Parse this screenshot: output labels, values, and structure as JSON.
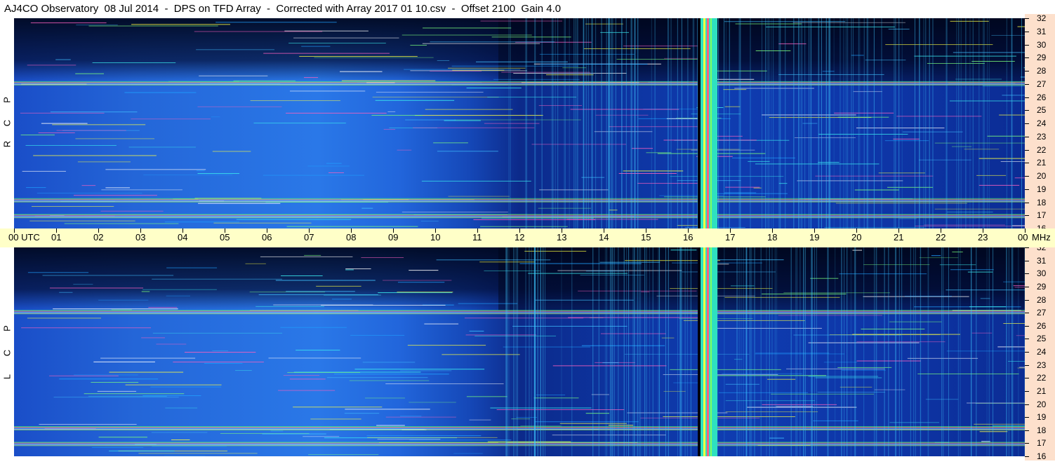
{
  "header": {
    "title": "AJ4CO Observatory  08 Jul 2014  -  DPS on TFD Array  -  Corrected with Array 2017 01 10.csv  -  Offset 2100  Gain 4.0"
  },
  "panels": [
    {
      "id": "rcp",
      "polarization_letters": [
        "R",
        "C",
        "P"
      ]
    },
    {
      "id": "lcp",
      "polarization_letters": [
        "L",
        "C",
        "P"
      ]
    }
  ],
  "time_axis": {
    "labels": [
      "00  UTC",
      "01",
      "02",
      "03",
      "04",
      "05",
      "06",
      "07",
      "08",
      "09",
      "10",
      "11",
      "12",
      "13",
      "14",
      "15",
      "16",
      "17",
      "18",
      "19",
      "20",
      "21",
      "22",
      "23",
      "00"
    ],
    "unit": "MHz"
  },
  "freq_axis": {
    "labels": [
      "32",
      "31",
      "30",
      "29",
      "28",
      "27",
      "26",
      "25",
      "24",
      "23",
      "22",
      "21",
      "20",
      "19",
      "18",
      "17",
      "16"
    ]
  },
  "colors": {
    "background_dark": "#000a3c",
    "background_blue": "#1e5ad2",
    "time_axis_bg": "#ffffc8",
    "freq_axis_bg": "#fde0cc"
  },
  "chart_data": {
    "type": "heatmap",
    "title": "AJ4CO Observatory  08 Jul 2014  -  DPS on TFD Array  -  Corrected with Array 2017 01 10.csv  -  Offset 2100  Gain 4.0",
    "xlabel": "UTC",
    "ylabel": "MHz",
    "x_range": [
      0,
      24
    ],
    "y_range": [
      16,
      32
    ],
    "panels": [
      "RCP",
      "LCP"
    ],
    "features": {
      "strong_broadband_burst_utc": [
        16.3,
        16.7
      ],
      "persistent_emission_mhz": [
        27.1,
        18.2,
        17.0
      ],
      "night_dark_region_utc": [
        11.5,
        24
      ]
    }
  }
}
